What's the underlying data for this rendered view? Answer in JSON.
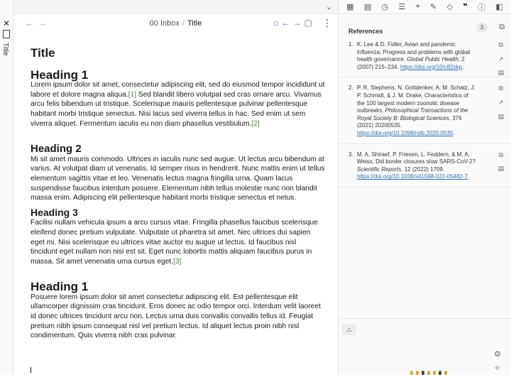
{
  "rail": {
    "title": "Title",
    "close": "✕"
  },
  "header": {
    "back": "←",
    "forward": "→",
    "crumb_folder": "00 Inbox",
    "crumb_sep": "/",
    "crumb_current": "Title",
    "more": "⋮",
    "collapse": "⌄"
  },
  "doc": {
    "title": "Title",
    "h1a": "Heading 1",
    "p1_a": "Lorem ipsum dolor sit amet, consectetur adipiscing elit, sed do eiusmod tempor incididunt ut labore et dolore magna aliqua.",
    "cite1": "[1]",
    "p1_b": " Sed blandit libero volutpat sed cras ornare arcu. Vivamus arcu felis bibendum ut tristique. Scelerisque mauris pellentesque pulvinar pellentesque habitant morbi tristique senectus. Nisi lacus sed viverra tellus in hac. Sed enim ut sem viverra aliquet. Fermentum iaculis eu non diam phasellus vestibulum.",
    "cite2": "[2]",
    "h2": "Heading 2",
    "p2": "Mi sit amet mauris commodo. Ultrices in iaculis nunc sed augue. Ut lectus arcu bibendum at varius. At volutpat diam ut venenatis. Id semper risus in hendrerit. Nunc mattis enim ut tellus elementum sagittis vitae et leo. Venenatis lectus magna fringilla urna. Quam lacus suspendisse faucibus interdum posuere. Elementum nibh tellus molestie nunc non blandit massa enim. Adipiscing elit pellentesque habitant morbi tristique senectus et netus.",
    "h3": "Heading 3",
    "p3": "Facilisi nullam vehicula ipsum a arcu cursus vitae. Fringilla phasellus faucibus scelerisque eleifend donec pretium vulputate. Vulputate ut pharetra sit amet. Nec ultrices dui sapien eget mi. Nisi scelerisque eu ultrices vitae auctor eu augue ut lectus. Id faucibus nisl tincidunt eget nullam non nisi est sit. Eget nunc lobortis mattis aliquam faucibus purus in massa. Sit amet venenatis urna cursus eget.",
    "cite3": "[3]",
    "h1b": "Heading 1",
    "p4": "Posuere lorem ipsum dolor sit amet consectetur adipiscing elit. Est pellentesque elit ullamcorper dignissim cras tincidunt. Eros donec ac odio tempor orci. Interdum velit laoreet id donec ultrices tincidunt arcu non. Lectus urna duis convallis convallis tellus id. Feugiat pretium nibh ipsum consequat nisl vel pretium lectus. Id aliquet lectus proin nibh nisl condimentum. Quis viverra nibh cras pulvinar."
  },
  "references": {
    "label": "References",
    "count": "3",
    "items": [
      {
        "num": "1.",
        "text": "K. Lee & D. Fidler, Avian and pandemic influenza: Progress and problems with global health governance. ",
        "journal": "Global Public Health",
        "details": ", 2 (2007) 215–234. ",
        "link": "https://doi.org/10/c82skp",
        "tail": "."
      },
      {
        "num": "2.",
        "text": "P. R. Stephens, N. Gottdenker, A. M. Schatz, J. P. Schmidt, & J. M. Drake, Characteristics of the 100 largest modern zoonotic disease outbreaks. ",
        "journal": "Philosophical Transactions of the Royal Society B: Biological Sciences",
        "details": ", 376 (2021) 20200535. ",
        "link": "https://doi.org/10.1098/rstb.2020.0535",
        "tail": "."
      },
      {
        "num": "3.",
        "text": "M. A. Shiraef, P. Friesen, L. Feddern, & M. A. Weiss, Did border closures slow SARS-CoV-2? ",
        "journal": "Scientific Reports",
        "details": ", 12 (2022) 1709. ",
        "link": "https://doi.org/10.1038/s41598-022-05482-7",
        "tail": "."
      }
    ]
  },
  "colors": {
    "link": "#2f6db5",
    "citation": "#4a8a3a",
    "accent": "#3a73c7"
  },
  "icons": [
    "calendar-icon",
    "archive-icon",
    "clock-icon",
    "list-icon",
    "tag-icon",
    "pen-icon",
    "tags-icon",
    "quote-icon",
    "info-icon",
    "sidebar-icon",
    "graph-icon",
    "gear-icon",
    "wand-icon"
  ]
}
